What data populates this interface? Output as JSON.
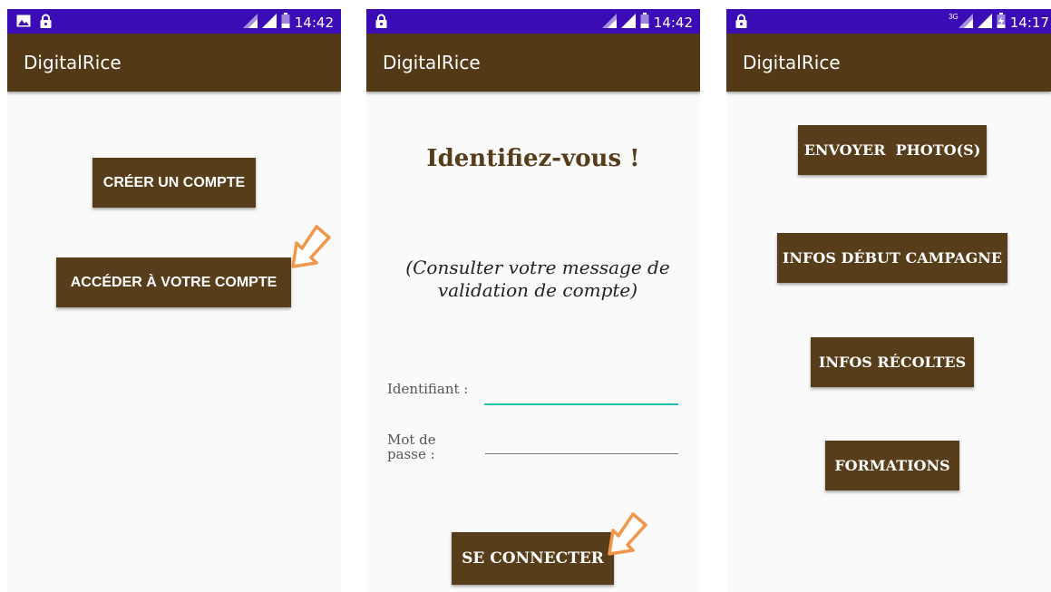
{
  "colors": {
    "status_bar": "#3b0cb5",
    "app_bar": "#533916",
    "button": "#573d1a",
    "title_text": "#573d1a",
    "focused_underline": "#1fbfb2",
    "annotation_arrow": "#f0974a"
  },
  "screens": [
    {
      "status": {
        "time": "14:42",
        "left_icons": [
          "image-icon",
          "lock-icon"
        ],
        "right_icons": [
          "signal-icon",
          "signal-icon",
          "battery-icon"
        ]
      },
      "app_title": "DigitalRice",
      "buttons": {
        "create_account": "CRÉER UN COMPTE",
        "access_account": "ACCÉDER À VOTRE COMPTE"
      }
    },
    {
      "status": {
        "time": "14:42",
        "left_icons": [
          "lock-icon"
        ],
        "right_icons": [
          "signal-icon",
          "signal-icon",
          "battery-icon"
        ]
      },
      "app_title": "DigitalRice",
      "heading": "Identifiez-vous !",
      "note": "(Consulter votre message de validation de compte)",
      "login_label": "Identifiant :",
      "password_label": "Mot de passe :",
      "login_value": "",
      "password_value": "",
      "connect_button": "SE CONNECTER"
    },
    {
      "status": {
        "time": "14:17",
        "network": "3G",
        "left_icons": [
          "lock-icon"
        ],
        "right_icons": [
          "signal-icon",
          "signal-icon",
          "battery-charging-icon"
        ]
      },
      "app_title": "DigitalRice",
      "buttons": {
        "send_photos": "ENVOYER  PHOTO(S)",
        "campaign_start": "INFOS DÉBUT CAMPAGNE",
        "harvests": "INFOS RÉCOLTES",
        "trainings": "FORMATIONS"
      }
    }
  ]
}
